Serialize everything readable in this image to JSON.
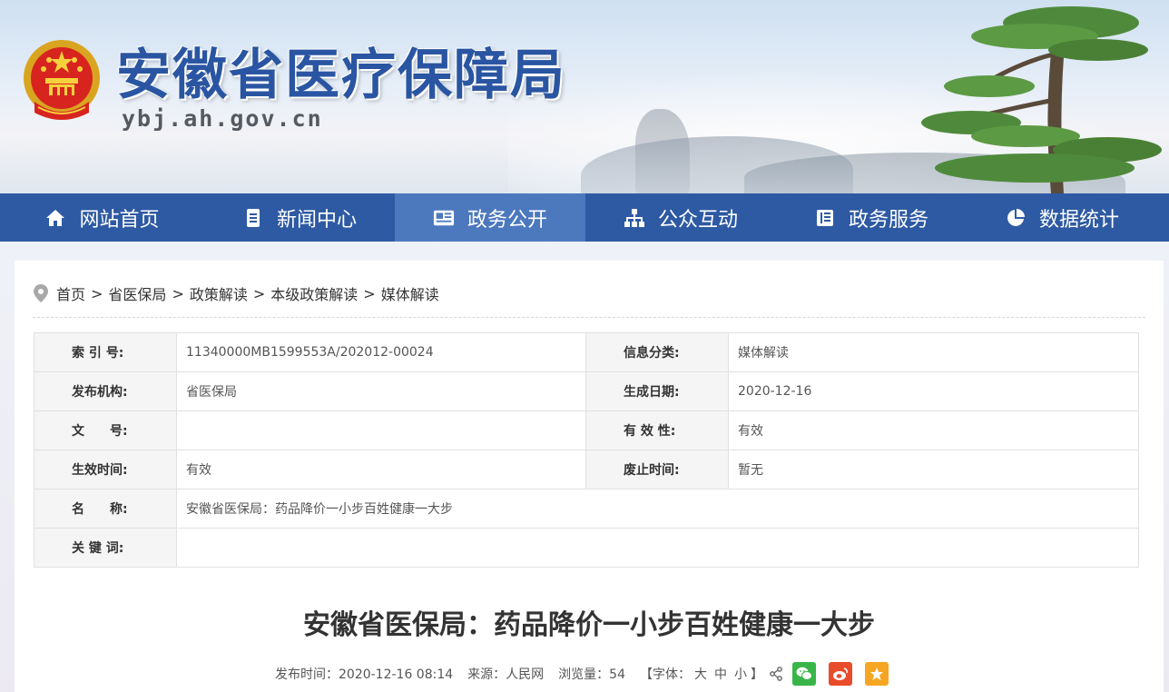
{
  "header": {
    "site_title": "安徽省医疗保障局",
    "site_domain": "ybj.ah.gov.cn",
    "emblem_icon": "national-emblem-icon"
  },
  "nav": {
    "items": [
      {
        "label": "网站首页",
        "icon": "home-icon"
      },
      {
        "label": "新闻中心",
        "icon": "document-icon"
      },
      {
        "label": "政务公开",
        "icon": "newspaper-icon",
        "active": true
      },
      {
        "label": "公众互动",
        "icon": "sitemap-icon"
      },
      {
        "label": "政务服务",
        "icon": "files-icon"
      },
      {
        "label": "数据统计",
        "icon": "pie-chart-icon"
      }
    ],
    "bg_color": "#2e5aa3",
    "active_color": "#4c78be"
  },
  "breadcrumb": {
    "items": [
      "首页",
      "省医保局",
      "政策解读",
      "本级政策解读",
      "媒体解读"
    ],
    "separator": ">"
  },
  "meta_table": {
    "index_label": "索 引 号:",
    "index_value": "11340000MB1599553A/202012-00024",
    "category_label": "信息分类:",
    "category_value": "媒体解读",
    "publisher_label": "发布机构:",
    "publisher_value": "省医保局",
    "created_label": "生成日期:",
    "created_value": "2020-12-16",
    "docno_label": "文　　号:",
    "docno_value": "",
    "validity_label": "有 效 性:",
    "validity_value": "有效",
    "effective_label": "生效时间:",
    "effective_value": "有效",
    "abolish_label": "废止时间:",
    "abolish_value": "暂无",
    "name_label": "名　　称:",
    "name_value": "安徽省医保局：药品降价一小步百姓健康一大步",
    "keywords_label": "关 键 词:",
    "keywords_value": ""
  },
  "article": {
    "title": "安徽省医保局：药品降价一小步百姓健康一大步",
    "publish_time": "发布时间：2020-12-16 08:14",
    "source": "来源：人民网",
    "views": "浏览量：54",
    "font_size_label": "【字体：",
    "font_large": "大",
    "font_medium": "中",
    "font_small": "小",
    "font_size_end": "】"
  }
}
